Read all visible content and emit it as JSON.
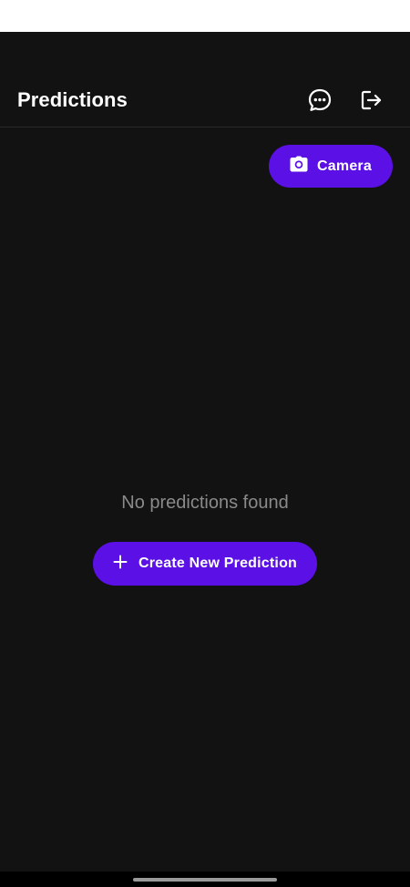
{
  "header": {
    "title": "Predictions",
    "chat_icon": "chat-bubble-dots-icon",
    "logout_icon": "logout-icon"
  },
  "camera_button": {
    "label": "Camera",
    "icon": "camera-icon"
  },
  "empty_state": {
    "message": "No predictions found",
    "create_button_label": "Create New Prediction",
    "create_icon": "plus-icon"
  },
  "colors": {
    "background": "#121212",
    "accent": "#5b10e6",
    "text_primary": "#ffffff",
    "text_muted": "#8a8a8a"
  }
}
